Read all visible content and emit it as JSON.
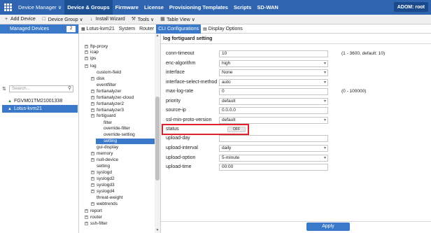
{
  "topbar": {
    "menu_device_manager": "Device Manager ∨",
    "menu_device_groups": "Device & Groups",
    "menu_firmware": "Firmware",
    "menu_license": "License",
    "menu_provisioning": "Provisioning Templates",
    "menu_scripts": "Scripts",
    "menu_sdwan": "SD-WAN",
    "adom": "ADOM: root"
  },
  "toolbar": {
    "add_device": "Add Device",
    "device_group": "Device Group ∨",
    "install_wizard": "Install Wizard",
    "tools": "Tools ∨",
    "table_view": "Table View ∨"
  },
  "leftpanel": {
    "managed_devices": "Managed Devices",
    "count": "2",
    "search_placeholder": "Search...",
    "devices": [
      "FGVM01TM21001338",
      "Lotus-kvm21"
    ]
  },
  "tabs": {
    "device": "Lotus-kvm21",
    "system": "System",
    "router": "Router",
    "cli": "CLI Configurations",
    "display": "Display Options"
  },
  "tree": [
    {
      "label": "ftp-proxy",
      "plus": true
    },
    {
      "label": "icap",
      "plus": true
    },
    {
      "label": "ips",
      "plus": true
    },
    {
      "label": "log",
      "plus": true
    },
    {
      "label": "custom-field",
      "plus": false
    },
    {
      "label": "disk",
      "plus": true
    },
    {
      "label": "eventfilter",
      "plus": false
    },
    {
      "label": "fortianalyzer",
      "plus": true
    },
    {
      "label": "fortianalyzer-cloud",
      "plus": true
    },
    {
      "label": "fortianalyzer2",
      "plus": true
    },
    {
      "label": "fortianalyzer3",
      "plus": true
    },
    {
      "label": "fortiguard",
      "plus": true
    },
    {
      "label": "filter",
      "plus": false
    },
    {
      "label": "override-filter",
      "plus": false
    },
    {
      "label": "override-setting",
      "plus": false
    },
    {
      "label": "setting",
      "plus": false
    },
    {
      "label": "gui-display",
      "plus": false
    },
    {
      "label": "memory",
      "plus": true
    },
    {
      "label": "null-device",
      "plus": true
    },
    {
      "label": "setting",
      "plus": false
    },
    {
      "label": "syslogd",
      "plus": true
    },
    {
      "label": "syslogd2",
      "plus": true
    },
    {
      "label": "syslogd3",
      "plus": true
    },
    {
      "label": "syslogd4",
      "plus": true
    },
    {
      "label": "threat-weight",
      "plus": false
    },
    {
      "label": "webtrends",
      "plus": true
    },
    {
      "label": "report",
      "plus": true
    },
    {
      "label": "router",
      "plus": true
    },
    {
      "label": "ssh-filter",
      "plus": true
    }
  ],
  "config": {
    "title": "log fortiguard setting",
    "fields": [
      {
        "label": "conn-timeout",
        "value": "10",
        "hint": "(1 - 3600, default: 10)"
      },
      {
        "label": "enc-algorithm",
        "value": "high"
      },
      {
        "label": "interface",
        "value": "None"
      },
      {
        "label": "interface-select-method",
        "value": "auto"
      },
      {
        "label": "max-log-rate",
        "value": "0",
        "hint": "(0 - 100000)"
      },
      {
        "label": "priority",
        "value": "default"
      },
      {
        "label": "source-ip",
        "value": "0.0.0.0"
      },
      {
        "label": "ssl-min-proto-version",
        "value": "default"
      },
      {
        "label": "status",
        "value": "OFF"
      },
      {
        "label": "upload-day",
        "value": ""
      },
      {
        "label": "upload-interval",
        "value": "daily"
      },
      {
        "label": "upload-option",
        "value": "5-minute"
      },
      {
        "label": "upload-time",
        "value": "00:00"
      }
    ],
    "apply": "Apply"
  },
  "colors": {
    "brand": "#2e64b0",
    "accent": "#3a78c9",
    "highlight": "#e0202a"
  }
}
